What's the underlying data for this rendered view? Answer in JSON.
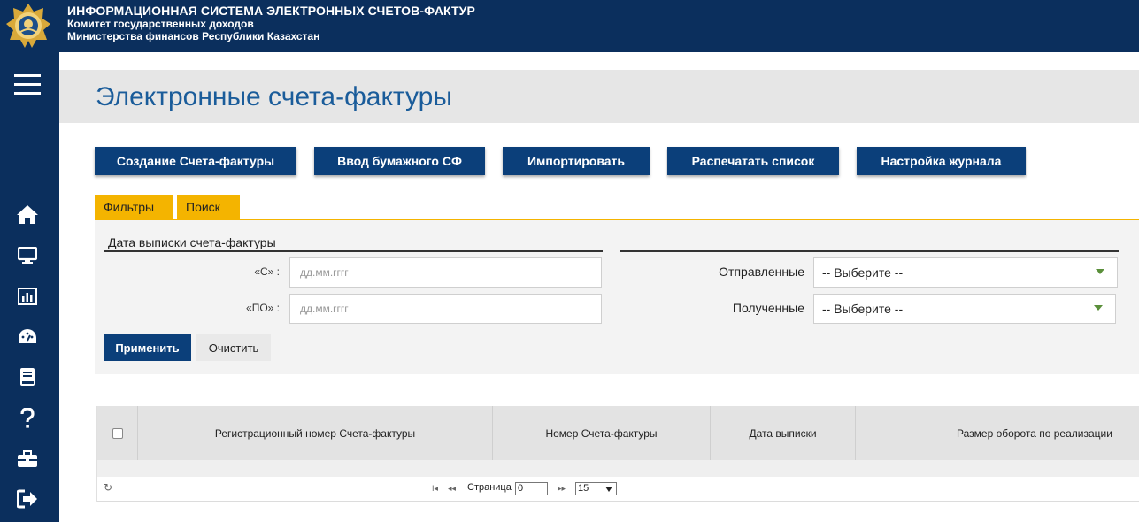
{
  "header": {
    "title": "ИНФОРМАЦИОННАЯ СИСТЕМА ЭЛЕКТРОННЫХ СЧЕТОВ-ФАКТУР",
    "subtitle1": "Комитет государственных доходов",
    "subtitle2": "Министерства финансов Республики Казахстан"
  },
  "sidebar": {
    "items": [
      {
        "icon": "home-icon"
      },
      {
        "icon": "monitor-icon"
      },
      {
        "icon": "chart-icon"
      },
      {
        "icon": "dashboard-icon"
      },
      {
        "icon": "book-icon"
      },
      {
        "icon": "help-icon"
      },
      {
        "icon": "briefcase-icon"
      },
      {
        "icon": "logout-icon"
      }
    ]
  },
  "page": {
    "title": "Электронные счета-фактуры"
  },
  "toolbar": {
    "create": "Создание Счета-фактуры",
    "paper": "Ввод бумажного СФ",
    "import": "Импортировать",
    "print": "Распечатать список",
    "settings": "Настройка журнала"
  },
  "tabs": {
    "filters": "Фильтры",
    "search": "Поиск"
  },
  "filters": {
    "date_section": "Дата выписки счета-фактуры",
    "from_label": "«С» :",
    "to_label": "«ПО» :",
    "date_placeholder": "дд.мм.гггг",
    "sent_label": "Отправленные",
    "received_label": "Полученные",
    "select_value": "-- Выберите --",
    "apply": "Применить",
    "clear": "Очистить"
  },
  "table": {
    "columns": [
      "Регистрационный номер Счета-фактуры",
      "Номер Счета-фактуры",
      "Дата выписки",
      "Размер оборота по реализации"
    ]
  },
  "pager": {
    "first": "I◂",
    "prev": "◂◂",
    "page_label": "Страница",
    "page_value": "0",
    "next": "▸▸",
    "rows": "15"
  },
  "colors": {
    "navy": "#0b2f5d",
    "button": "#0b3f7a",
    "tab": "#f4b400",
    "title": "#1a5c9a"
  }
}
